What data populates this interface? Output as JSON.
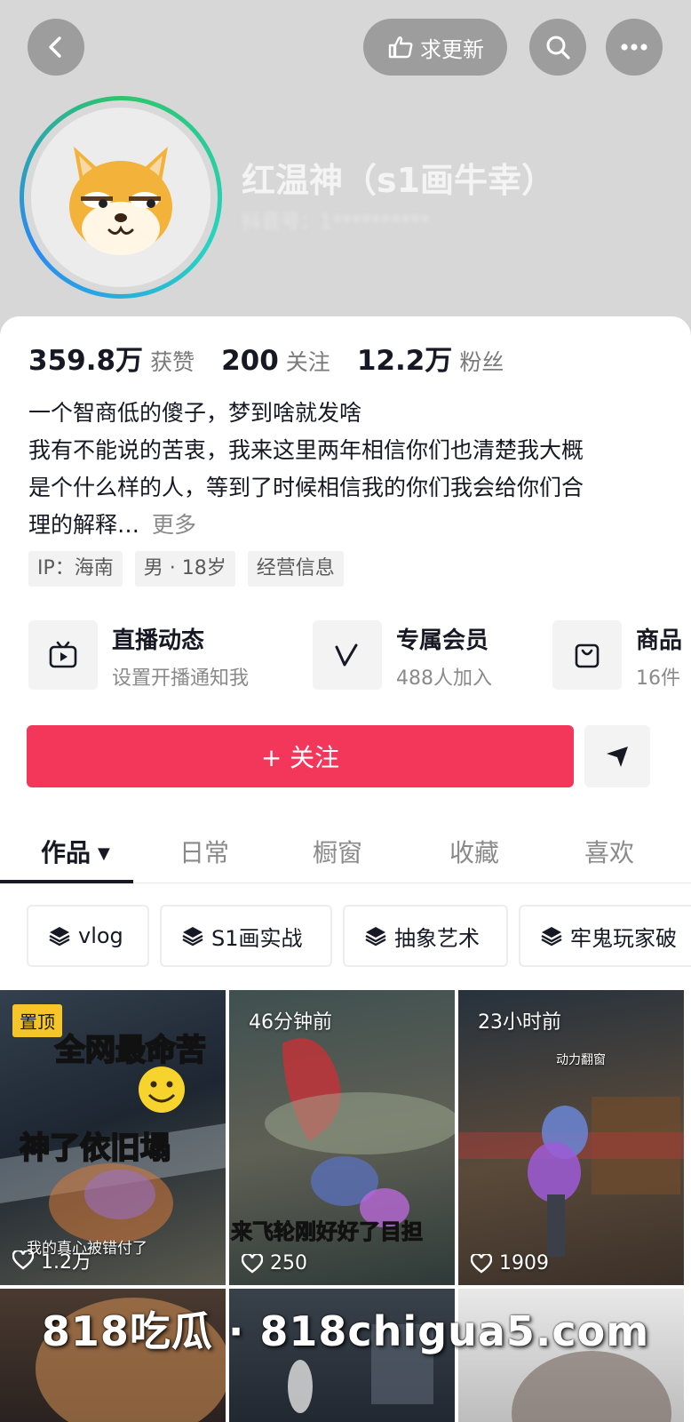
{
  "header": {
    "request_update_label": "求更新",
    "nickname": "红温神（s1画牛幸）",
    "douyin_id": "抖音号：1**********"
  },
  "stats": {
    "likes_num": "359.8万",
    "likes_label": "获赞",
    "following_num": "200",
    "following_label": "关注",
    "followers_num": "12.2万",
    "followers_label": "粉丝"
  },
  "bio": {
    "line1": "一个智商低的傻子，梦到啥就发啥",
    "line2": "我有不能说的苦衷，我来这里两年相信你们也清楚我大概",
    "line3": "是个什么样的人，等到了时候相信我的你们我会给你们合",
    "line4": "理的解释…",
    "more": "更多"
  },
  "tags": [
    "IP：海南",
    "男 · 18岁",
    "经营信息"
  ],
  "features": [
    {
      "title": "直播动态",
      "subtitle": "设置开播通知我",
      "icon": "tv-icon"
    },
    {
      "title": "专属会员",
      "subtitle": "488人加入",
      "icon": "v-icon"
    },
    {
      "title": "商品",
      "subtitle": "16件",
      "icon": "bag-icon"
    }
  ],
  "follow_label": "+ 关注",
  "tabs": [
    "作品",
    "日常",
    "橱窗",
    "收藏",
    "喜欢"
  ],
  "collections": [
    "vlog",
    "S1画实战",
    "抽象艺术",
    "牢鬼玩家破"
  ],
  "videos": [
    {
      "badge": "置顶",
      "title_line1": "全网最命苦",
      "title_line2": "神了依旧塌",
      "caption": "我的真心被错付了",
      "likes": "1.2万"
    },
    {
      "time": "46分钟前",
      "caption": "来飞轮刚好好了目担",
      "likes": "250"
    },
    {
      "time": "23小时前",
      "caption": "动力翻窗",
      "likes": "1909"
    }
  ],
  "watermark": "818吃瓜 · 818chigua5.com",
  "colors": {
    "accent": "#f2375a",
    "pin_badge": "#f6c52a"
  }
}
